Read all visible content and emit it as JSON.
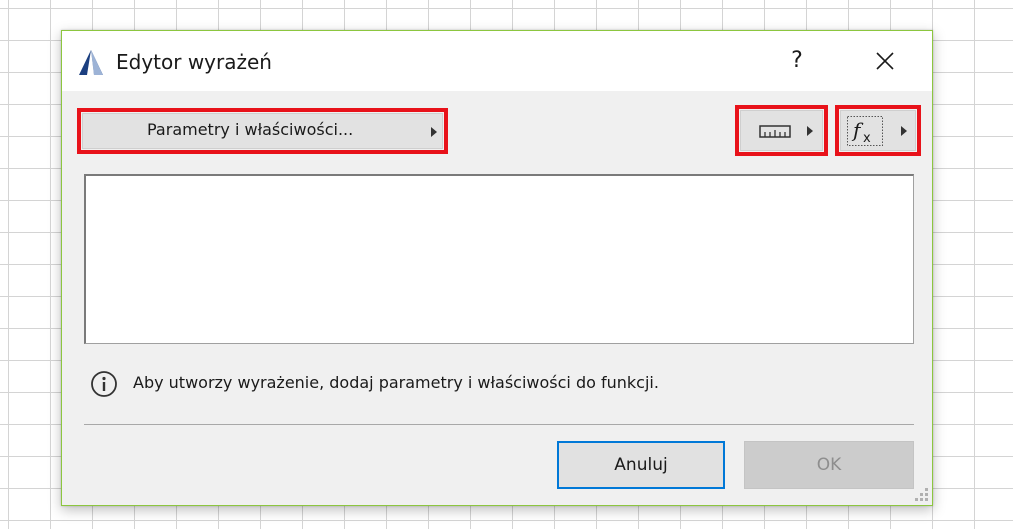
{
  "dialog": {
    "title": "Edytor wyrażeń",
    "help_label": "?",
    "close_icon": "close-icon",
    "logo_icon": "archicad-logo-icon"
  },
  "toolbar": {
    "params_button_label": "Parametry i właściwości...",
    "units_icon": "ruler-icon",
    "function_icon": "function-fx-icon",
    "highlight_color": "#e8121a"
  },
  "editor": {
    "value": ""
  },
  "info": {
    "icon": "info-icon",
    "text": "Aby utworzy wyrażenie, dodaj parametry i właściwości do funkcji."
  },
  "footer": {
    "cancel_label": "Anuluj",
    "ok_label": "OK",
    "focus_color": "#0078d7"
  }
}
